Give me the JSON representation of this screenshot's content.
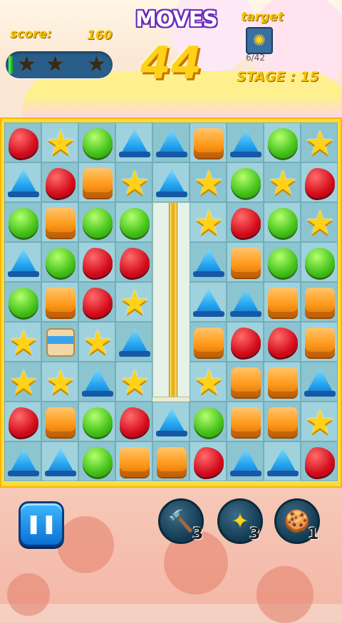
{
  "hud": {
    "score_label": "score:",
    "score_value": "160",
    "moves_label": "MOVES",
    "moves_value": "44",
    "target_label": "target",
    "target_progress": "6/42",
    "stage_text": "STAGE : 15",
    "rating_stars": [
      "★",
      "★",
      "★"
    ],
    "target_icon": "snowflake-block-icon"
  },
  "board": {
    "rows": 9,
    "cols": 9,
    "grid": [
      [
        "red",
        "star",
        "green",
        "blue",
        "blue",
        "orange",
        "blue",
        "green",
        "star"
      ],
      [
        "blue",
        "red",
        "orange",
        "star",
        "blue",
        "star",
        "green",
        "star",
        "red"
      ],
      [
        "green",
        "orange",
        "green",
        "green",
        "pipe",
        "star",
        "red",
        "green",
        "star"
      ],
      [
        "blue",
        "green",
        "red",
        "red",
        "pipe",
        "blue",
        "orange",
        "green",
        "green"
      ],
      [
        "green",
        "orange",
        "red",
        "star",
        "pipe",
        "blue",
        "blue",
        "orange",
        "orange"
      ],
      [
        "star",
        "smore",
        "star",
        "blue",
        "pipe",
        "orange",
        "red",
        "red",
        "orange"
      ],
      [
        "star",
        "star",
        "blue",
        "star",
        "pipe",
        "star",
        "orange",
        "orange",
        "blue"
      ],
      [
        "red",
        "orange",
        "green",
        "red",
        "blue",
        "green",
        "orange",
        "orange",
        "star"
      ],
      [
        "blue",
        "blue",
        "green",
        "orange",
        "orange",
        "red",
        "blue",
        "blue",
        "red"
      ]
    ],
    "colors": {
      "red": "#d40d1c",
      "green": "#44c21a",
      "blue": "#21a3ef",
      "orange": "#ff9a1a",
      "star": "#ffd21a"
    }
  },
  "boosters": [
    {
      "name": "hammer-booster",
      "icon": "🔨",
      "count": "3"
    },
    {
      "name": "color-bomb-booster",
      "icon": "✦",
      "count": "3"
    },
    {
      "name": "cookie-booster",
      "icon": "🍪",
      "count": "1"
    }
  ],
  "pause_icon": "❚❚"
}
